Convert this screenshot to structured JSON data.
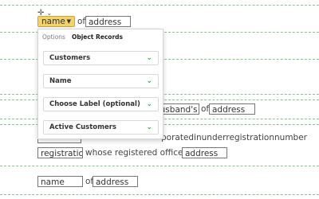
{
  "row1": {
    "tag_label": "name",
    "connector": "of",
    "field_value": "address"
  },
  "popup": {
    "tabs": [
      {
        "label": "Options",
        "active": false
      },
      {
        "label": "Object Records",
        "active": true
      }
    ],
    "selects": [
      {
        "label": "Customers"
      },
      {
        "label": "Name"
      },
      {
        "label": "Choose Label (optional)"
      },
      {
        "label": "Active Customers"
      }
    ]
  },
  "row_husband": {
    "field1_value": "husband's n",
    "connector": "of",
    "field2_value": "address"
  },
  "row_company": {
    "words": [
      "porated",
      "in",
      "under",
      "registration",
      "number"
    ]
  },
  "row_registration": {
    "field1_value": "registration",
    "text": "whose registered office is at",
    "field2_value": "address"
  },
  "row_last": {
    "field1_value": "name",
    "connector": "of",
    "field2_value": "address"
  },
  "icons": {
    "move": "move-icon",
    "caret": "chevron-down-icon"
  },
  "colors": {
    "tag_background": "#f2d36b",
    "dashed_divider": "#8cc28c",
    "select_chevron": "#3aa357"
  }
}
